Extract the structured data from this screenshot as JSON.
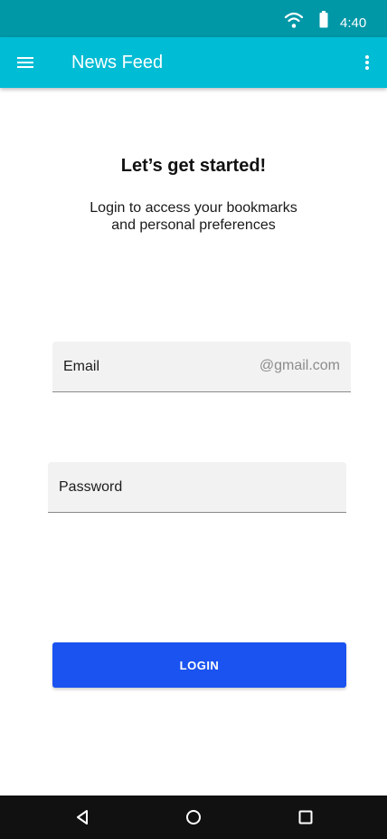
{
  "status_bar": {
    "time": "4:40",
    "icons": [
      "wifi-icon",
      "battery-icon"
    ]
  },
  "app_bar": {
    "title": "News Feed",
    "menu_icon": "hamburger-menu-icon",
    "overflow_icon": "more-vert-icon"
  },
  "header": {
    "headline": "Let’s get started!",
    "subtext": "Login to access your bookmarks\nand personal preferences"
  },
  "form": {
    "email_label": "Email",
    "email_suffix": "@gmail.com",
    "password_label": "Password",
    "login_label": "LOGIN"
  },
  "nav_bar": {
    "icons": [
      "back-icon",
      "home-icon",
      "recents-icon"
    ]
  },
  "colors": {
    "status_bar": "#0097a7",
    "app_bar": "#00bcd4",
    "login_button": "#1a53f0",
    "nav_bar": "#111111"
  }
}
